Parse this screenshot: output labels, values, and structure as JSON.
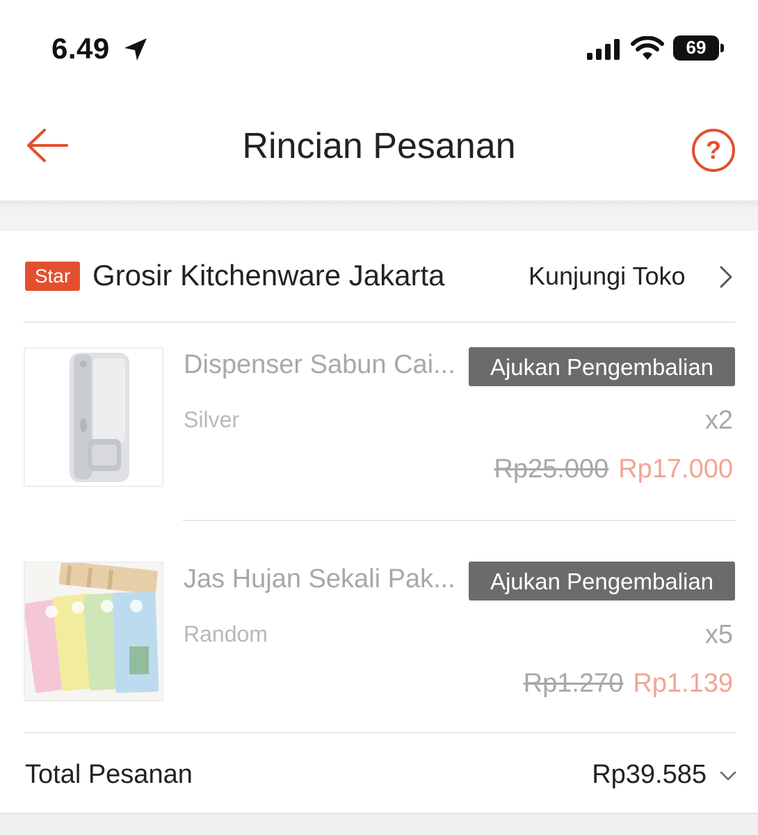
{
  "status_bar": {
    "time": "6.49",
    "battery": "69",
    "icons": [
      "location-arrow-icon",
      "cellular-signal-icon",
      "wifi-icon",
      "battery-icon"
    ]
  },
  "header": {
    "title": "Rincian Pesanan",
    "back_icon": "arrow-left-icon",
    "help_icon": "question-circle-icon",
    "accent_color": "#e3502f"
  },
  "shop": {
    "badge": "Star",
    "name": "Grosir Kitchenware Jakarta",
    "visit_label": "Kunjungi Toko"
  },
  "items": [
    {
      "name": "Dispenser Sabun Cai...",
      "variant": "Silver",
      "quantity": "x2",
      "original_price": "Rp25.000",
      "price": "Rp17.000",
      "action_label": "Ajukan Pengembalian"
    },
    {
      "name": "Jas Hujan Sekali Pak...",
      "variant": "Random",
      "quantity": "x5",
      "original_price": "Rp1.270",
      "price": "Rp1.139",
      "action_label": "Ajukan Pengembalian"
    }
  ],
  "total": {
    "label": "Total Pesanan",
    "value": "Rp39.585"
  }
}
